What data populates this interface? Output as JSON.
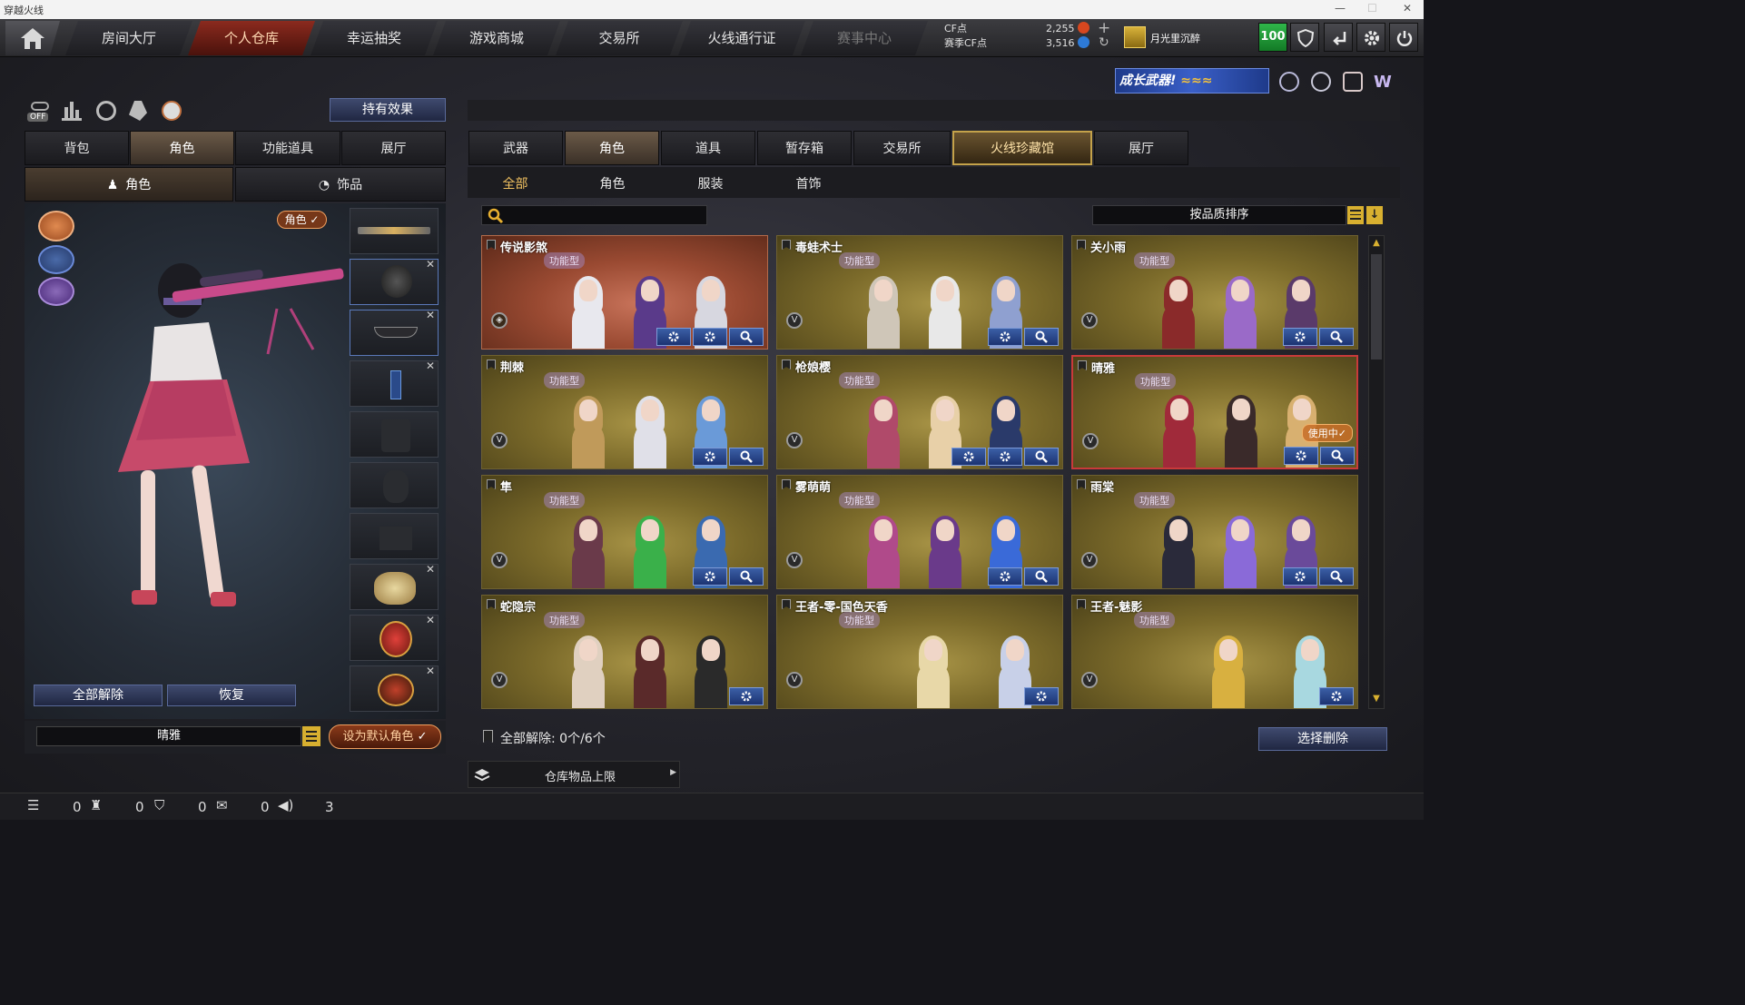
{
  "window": {
    "title": "穿越火线"
  },
  "nav": {
    "tabs": [
      "房间大厅",
      "个人仓库",
      "幸运抽奖",
      "游戏商城",
      "交易所",
      "火线通行证",
      "赛事中心"
    ],
    "active": 1
  },
  "currency": {
    "cf_label": "CF点",
    "cf_value": "2,255",
    "season_label": "赛季CF点",
    "season_value": "3,516"
  },
  "user": {
    "name": "月光里沉醉",
    "level": "100"
  },
  "banner": {
    "text": "成长武器!"
  },
  "left": {
    "toolbar": {
      "off_label": "OFF",
      "effect_button": "持有效果"
    },
    "tabs": [
      "背包",
      "角色",
      "功能道具",
      "展厅"
    ],
    "active_tab": 1,
    "subtabs": [
      "角色",
      "饰品"
    ],
    "active_subtab": 0,
    "role_badge": "角色 ✓",
    "release_all": "全部解除",
    "restore": "恢复",
    "role_select": "晴雅",
    "set_default": "设为默认角色"
  },
  "right": {
    "tabs": [
      "武器",
      "角色",
      "道具",
      "暂存箱",
      "交易所",
      "火线珍藏馆",
      "展厅"
    ],
    "active_tab": 5,
    "subtabs": [
      "全部",
      "角色",
      "服装",
      "首饰"
    ],
    "active_subtab": 0,
    "search_placeholder": "",
    "sort_label": "按品质排序",
    "cards": [
      {
        "name": "传说影煞",
        "type": "功能型",
        "style": "red",
        "buttons": 3,
        "in_use": "",
        "colors": [
          "#e8e8ee",
          "#5a3a8a",
          "#d7d7e0"
        ]
      },
      {
        "name": "毒蛙术士",
        "type": "功能型",
        "style": "gold",
        "buttons": 2,
        "in_use": "",
        "colors": [
          "#cfc6b8",
          "#e8e8e8",
          "#8fa0d0"
        ]
      },
      {
        "name": "关小雨",
        "type": "功能型",
        "style": "gold",
        "buttons": 2,
        "in_use": "",
        "colors": [
          "#8a2a2a",
          "#9a6ac8",
          "#5a3a6a"
        ]
      },
      {
        "name": "荆棘",
        "type": "功能型",
        "style": "gold",
        "buttons": 2,
        "in_use": "",
        "colors": [
          "#c09a5a",
          "#e0e0e8",
          "#6a9ad8"
        ]
      },
      {
        "name": "枪娘樱",
        "type": "功能型",
        "style": "gold",
        "buttons": 3,
        "in_use": "",
        "colors": [
          "#b04a6a",
          "#e8d0a8",
          "#2a3a6a"
        ]
      },
      {
        "name": "晴雅",
        "type": "功能型",
        "style": "gold",
        "buttons": 2,
        "in_use": "使用中✓",
        "colors": [
          "#a02a3a",
          "#3a2a2a",
          "#d8b070"
        ]
      },
      {
        "name": "隼",
        "type": "功能型",
        "style": "gold",
        "buttons": 2,
        "in_use": "",
        "colors": [
          "#6a3a4a",
          "#3ab04a",
          "#3a6ab0"
        ]
      },
      {
        "name": "雾萌萌",
        "type": "功能型",
        "style": "gold",
        "buttons": 2,
        "in_use": "",
        "colors": [
          "#b04a8a",
          "#6a3a8a",
          "#3a6ad8"
        ]
      },
      {
        "name": "雨棠",
        "type": "功能型",
        "style": "gold",
        "buttons": 2,
        "in_use": "",
        "colors": [
          "#2a2a3a",
          "#8a6ad8",
          "#6a4a9a"
        ]
      },
      {
        "name": "蛇隐宗",
        "type": "功能型",
        "style": "gold",
        "buttons": 1,
        "in_use": "",
        "colors": [
          "#e0d0c0",
          "#5a2a2a",
          "#2a2a2a"
        ]
      },
      {
        "name": "王者-零-国色天香",
        "type": "功能型",
        "style": "gold",
        "buttons": 1,
        "in_use": "",
        "colors": [
          "#e8d8a8",
          "#c8d0e8"
        ]
      },
      {
        "name": "王者-魅影",
        "type": "功能型",
        "style": "gold",
        "buttons": 1,
        "in_use": "",
        "colors": [
          "#d8b040",
          "#a8d8e0"
        ]
      }
    ],
    "footer": {
      "release_text": "全部解除: 0个/6个",
      "select_delete": "选择删除",
      "storage_limit": "仓库物品上限"
    }
  },
  "status": {
    "items": [
      "0",
      "0",
      "0",
      "0",
      "3"
    ]
  }
}
